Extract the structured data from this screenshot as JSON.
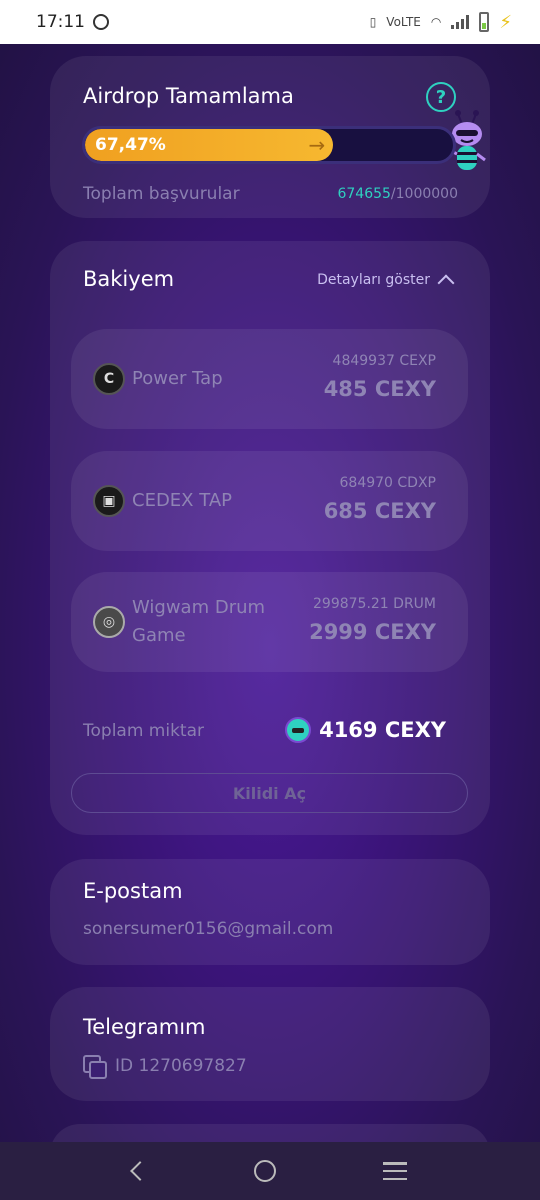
{
  "status_bar": {
    "time": "17:11",
    "network": "VoLTE"
  },
  "airdrop": {
    "title": "Airdrop Tamamlama",
    "help": "?",
    "progress_label": "67,47%",
    "progress_value": 0.6747,
    "applications_label": "Toplam başvurular",
    "applications_current": "674655",
    "applications_total": "/1000000"
  },
  "balance": {
    "title": "Bakiyem",
    "details_toggle": "Detayları göster",
    "tokens": [
      {
        "name": "Power Tap",
        "sub": "4849937 CEXP",
        "amount": "485 CEXY",
        "icon": "power-tap-logo"
      },
      {
        "name": "CEDEX TAP",
        "sub": "684970 CDXP",
        "amount": "685 CEXY",
        "icon": "cedex-tap-logo"
      },
      {
        "name": "Wigwam Drum Game",
        "sub": "299875.21 DRUM",
        "amount": "2999 CEXY",
        "icon": "wigwam-drum-logo"
      }
    ],
    "total_label": "Toplam miktar",
    "total_value": "4169 CEXY",
    "unlock_button": "Kilidi Aç"
  },
  "email": {
    "title": "E-postam",
    "value": "sonersumer0156@gmail.com"
  },
  "telegram": {
    "title": "Telegramım",
    "id": "ID 1270697827"
  },
  "colors": {
    "accent": "#2fd1c0",
    "progress": "#f6b830",
    "background": "#3a1478"
  }
}
